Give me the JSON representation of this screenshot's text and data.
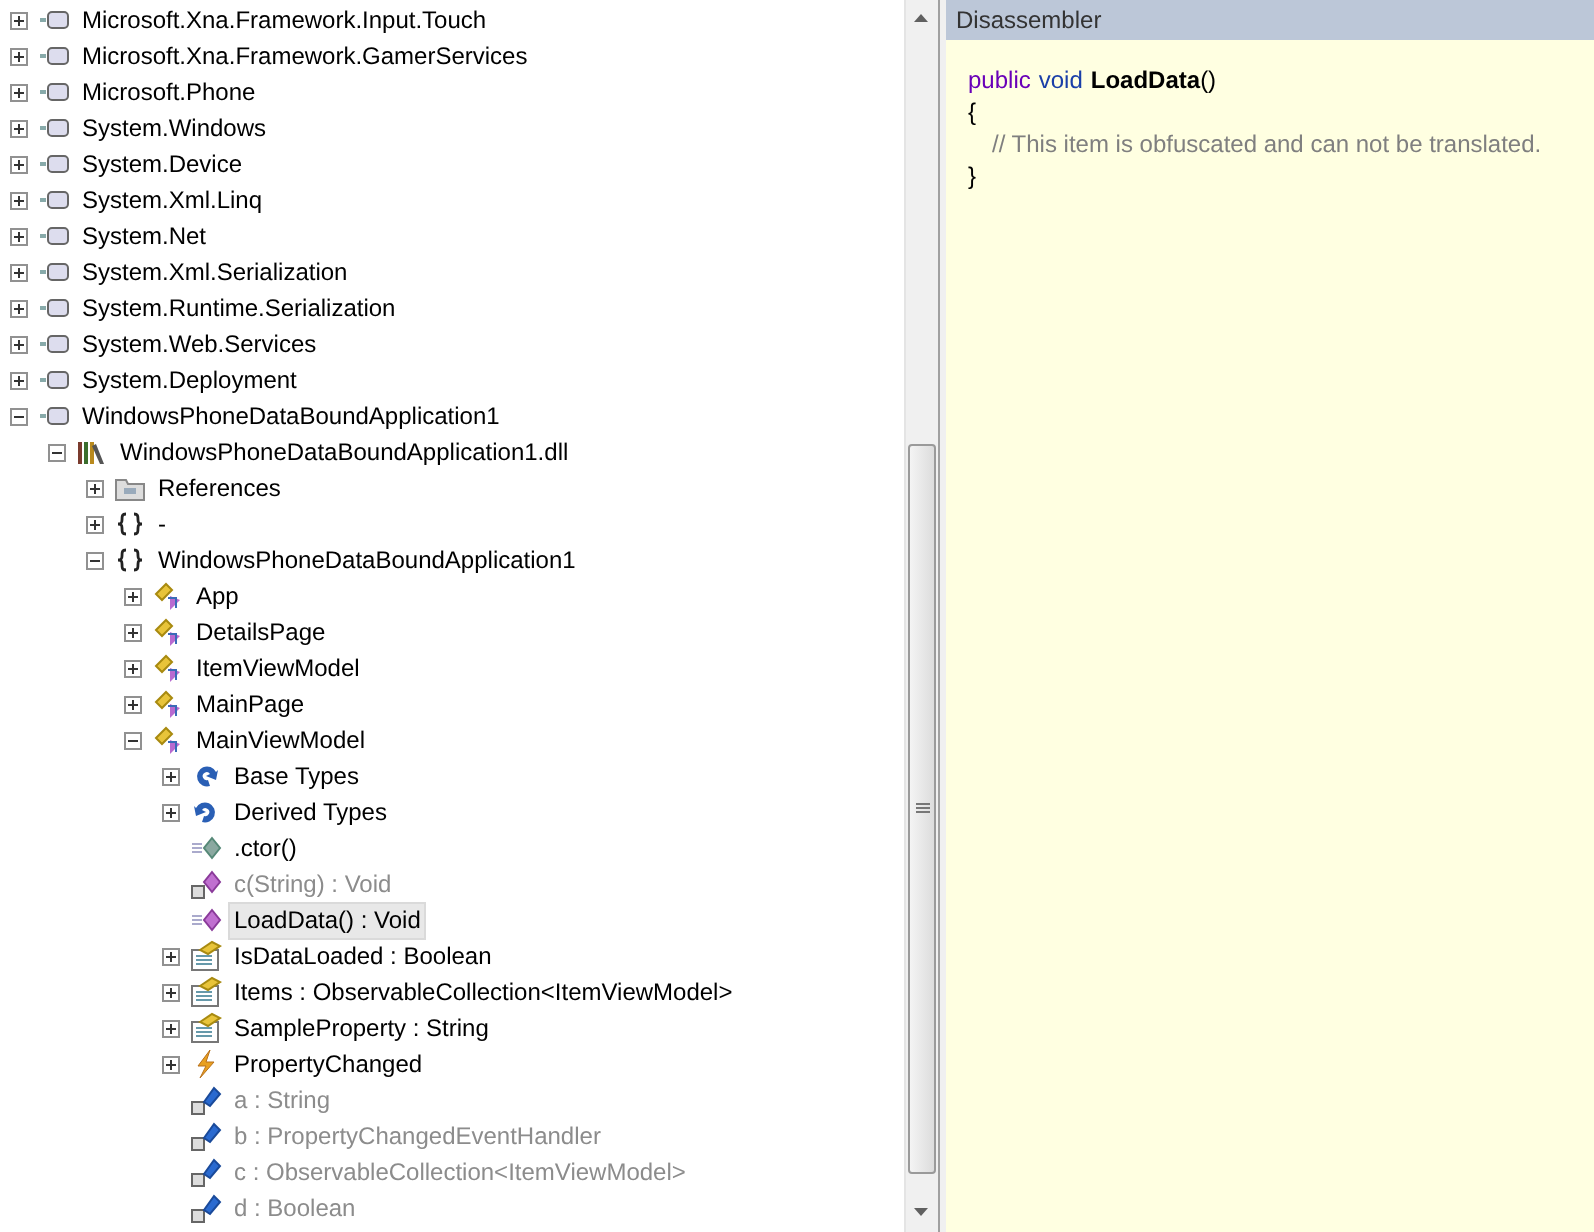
{
  "tree": {
    "items": [
      {
        "label": "Microsoft.Xna.Framework.Input.Touch",
        "kind": "assembly",
        "expanded": false,
        "selected": false,
        "dimmed": false
      },
      {
        "label": "Microsoft.Xna.Framework.GamerServices",
        "kind": "assembly",
        "expanded": false,
        "selected": false,
        "dimmed": false
      },
      {
        "label": "Microsoft.Phone",
        "kind": "assembly",
        "expanded": false,
        "selected": false,
        "dimmed": false
      },
      {
        "label": "System.Windows",
        "kind": "assembly",
        "expanded": false,
        "selected": false,
        "dimmed": false
      },
      {
        "label": "System.Device",
        "kind": "assembly",
        "expanded": false,
        "selected": false,
        "dimmed": false
      },
      {
        "label": "System.Xml.Linq",
        "kind": "assembly",
        "expanded": false,
        "selected": false,
        "dimmed": false
      },
      {
        "label": "System.Net",
        "kind": "assembly",
        "expanded": false,
        "selected": false,
        "dimmed": false
      },
      {
        "label": "System.Xml.Serialization",
        "kind": "assembly",
        "expanded": false,
        "selected": false,
        "dimmed": false
      },
      {
        "label": "System.Runtime.Serialization",
        "kind": "assembly",
        "expanded": false,
        "selected": false,
        "dimmed": false
      },
      {
        "label": "System.Web.Services",
        "kind": "assembly",
        "expanded": false,
        "selected": false,
        "dimmed": false
      },
      {
        "label": "System.Deployment",
        "kind": "assembly",
        "expanded": false,
        "selected": false,
        "dimmed": false
      },
      {
        "label": "WindowsPhoneDataBoundApplication1",
        "kind": "assembly",
        "expanded": true,
        "selected": false,
        "dimmed": false,
        "children": [
          {
            "label": "WindowsPhoneDataBoundApplication1.dll",
            "kind": "library",
            "expanded": true,
            "selected": false,
            "dimmed": false,
            "children": [
              {
                "label": "References",
                "kind": "references",
                "expanded": false,
                "selected": false,
                "dimmed": false
              },
              {
                "label": "-",
                "kind": "namespace",
                "expanded": false,
                "selected": false,
                "dimmed": false
              },
              {
                "label": "WindowsPhoneDataBoundApplication1",
                "kind": "namespace",
                "expanded": true,
                "selected": false,
                "dimmed": false,
                "children": [
                  {
                    "label": "App",
                    "kind": "class",
                    "expanded": false,
                    "selected": false,
                    "dimmed": false
                  },
                  {
                    "label": "DetailsPage",
                    "kind": "class",
                    "expanded": false,
                    "selected": false,
                    "dimmed": false
                  },
                  {
                    "label": "ItemViewModel",
                    "kind": "class",
                    "expanded": false,
                    "selected": false,
                    "dimmed": false
                  },
                  {
                    "label": "MainPage",
                    "kind": "class",
                    "expanded": false,
                    "selected": false,
                    "dimmed": false
                  },
                  {
                    "label": "MainViewModel",
                    "kind": "class",
                    "expanded": true,
                    "selected": false,
                    "dimmed": false,
                    "children": [
                      {
                        "label": "Base Types",
                        "kind": "base-types",
                        "expanded": false,
                        "selected": false,
                        "dimmed": false
                      },
                      {
                        "label": "Derived Types",
                        "kind": "derived-types",
                        "expanded": false,
                        "selected": false,
                        "dimmed": false
                      },
                      {
                        "label": ".ctor()",
                        "kind": "constructor",
                        "selected": false,
                        "dimmed": false
                      },
                      {
                        "label": "c(String) : Void",
                        "kind": "private-method",
                        "selected": false,
                        "dimmed": true
                      },
                      {
                        "label": "LoadData() : Void",
                        "kind": "method",
                        "selected": true,
                        "dimmed": false
                      },
                      {
                        "label": "IsDataLoaded : Boolean",
                        "kind": "property",
                        "expanded": false,
                        "selected": false,
                        "dimmed": false
                      },
                      {
                        "label": "Items : ObservableCollection<ItemViewModel>",
                        "kind": "property",
                        "expanded": false,
                        "selected": false,
                        "dimmed": false
                      },
                      {
                        "label": "SampleProperty : String",
                        "kind": "property",
                        "expanded": false,
                        "selected": false,
                        "dimmed": false
                      },
                      {
                        "label": "PropertyChanged",
                        "kind": "event",
                        "expanded": false,
                        "selected": false,
                        "dimmed": false
                      },
                      {
                        "label": "a : String",
                        "kind": "private-field",
                        "selected": false,
                        "dimmed": true
                      },
                      {
                        "label": "b : PropertyChangedEventHandler",
                        "kind": "private-field",
                        "selected": false,
                        "dimmed": true
                      },
                      {
                        "label": "c : ObservableCollection<ItemViewModel>",
                        "kind": "private-field",
                        "selected": false,
                        "dimmed": true
                      },
                      {
                        "label": "d : Boolean",
                        "kind": "private-field",
                        "selected": false,
                        "dimmed": true
                      }
                    ]
                  }
                ]
              }
            ]
          }
        ]
      }
    ]
  },
  "disassembler": {
    "title": "Disassembler",
    "lines": [
      [
        {
          "kind": "keyword",
          "text": "public"
        },
        {
          "kind": "type",
          "text": "void"
        },
        {
          "kind": "name",
          "text": "LoadData"
        },
        {
          "kind": "plain",
          "text": "()"
        }
      ],
      [
        {
          "kind": "plain",
          "text": "{"
        }
      ],
      [
        {
          "kind": "comment",
          "text": "// This item is obfuscated and can not be translated."
        }
      ],
      [
        {
          "kind": "plain",
          "text": "}"
        }
      ]
    ]
  }
}
